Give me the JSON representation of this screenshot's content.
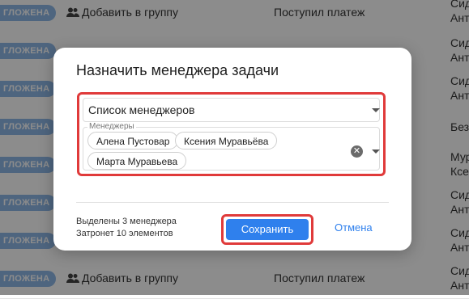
{
  "table": {
    "rows": [
      {
        "badge": "ГЛОЖЕНА",
        "action": "Добавить в группу",
        "event": "Поступил платеж",
        "person": [
          "Сид",
          "Ант"
        ]
      },
      {
        "badge": "ГЛОЖЕНА",
        "action": "",
        "event": "",
        "person": [
          "Сид",
          "Ант"
        ]
      },
      {
        "badge": "ГЛОЖЕНА",
        "action": "",
        "event": "",
        "person": [
          "Сид",
          "Ант"
        ]
      },
      {
        "badge": "ГЛОЖЕНА",
        "action": "",
        "event": "",
        "person": [
          "Без"
        ]
      },
      {
        "badge": "ГЛОЖЕНА",
        "action": "",
        "event": "",
        "person": [
          "Мур",
          "Ксен"
        ]
      },
      {
        "badge": "ГЛОЖЕНА",
        "action": "",
        "event": "",
        "person": [
          "Сид",
          "Ант"
        ]
      },
      {
        "badge": "ГЛОЖЕНА",
        "action": "",
        "event": "",
        "person": [
          "Сид",
          "Ант"
        ]
      },
      {
        "badge": "ГЛОЖЕНА",
        "action": "Добавить в группу",
        "event": "Поступил платеж",
        "person": [
          "Сид",
          "Ант"
        ]
      }
    ]
  },
  "modal": {
    "title": "Назначить менеджера задачи",
    "select_label": "Список менеджеров",
    "multiselect_legend": "Менеджеры",
    "chips": [
      "Алена Пустовар",
      "Ксения Муравьёва",
      "Марта Муравьева"
    ],
    "clear_glyph": "✕",
    "info_line1": "Выделены 3 менеджера",
    "info_line2": "Затронет 10 элементов",
    "save_label": "Сохранить",
    "cancel_label": "Отмена"
  },
  "colors": {
    "accent": "#2f80ed",
    "highlight": "#e03a3a",
    "badge": "#8fb8e8"
  },
  "icons": {
    "group": "users-icon",
    "caret": "chevron-down-icon",
    "clear": "clear-icon"
  }
}
